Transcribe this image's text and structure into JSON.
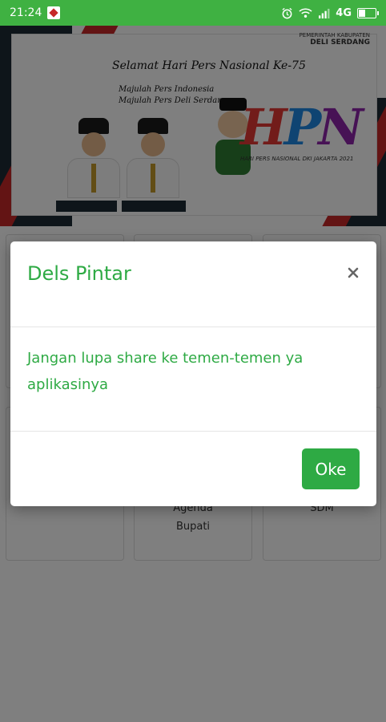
{
  "status_bar": {
    "time": "21:24",
    "network": "4G",
    "battery_level_pct": 45,
    "icons": [
      "app-notification-icon",
      "alarm-icon",
      "wifi-icon",
      "signal-icon",
      "battery-icon"
    ]
  },
  "banner": {
    "title": "Selamat Hari Pers Nasional Ke-75",
    "subtitle_1": "Majulah Pers Indonesia",
    "subtitle_2": "Majulah Pers Deli Serdang",
    "gov_small": "PEMERINTAH KABUPATEN",
    "gov_name": "DELI SERDANG",
    "logo_h": "H",
    "logo_p": "P",
    "logo_n": "N",
    "logo_caption": "HARI PERS NASIONAL DKI JAKARTA 2021"
  },
  "tiles": {
    "agenda_label_1": "Agenda",
    "agenda_label_2": "Bupati",
    "sdm_label": "SDM"
  },
  "dialog": {
    "title": "Dels Pintar",
    "message": "Jangan lupa share ke temen-temen ya aplikasinya",
    "ok_label": "Oke"
  },
  "colors": {
    "status_bar": "#3fb142",
    "accent_green": "#2eaa44",
    "banner_red": "#c62828",
    "banner_dark": "#1d2a35"
  }
}
